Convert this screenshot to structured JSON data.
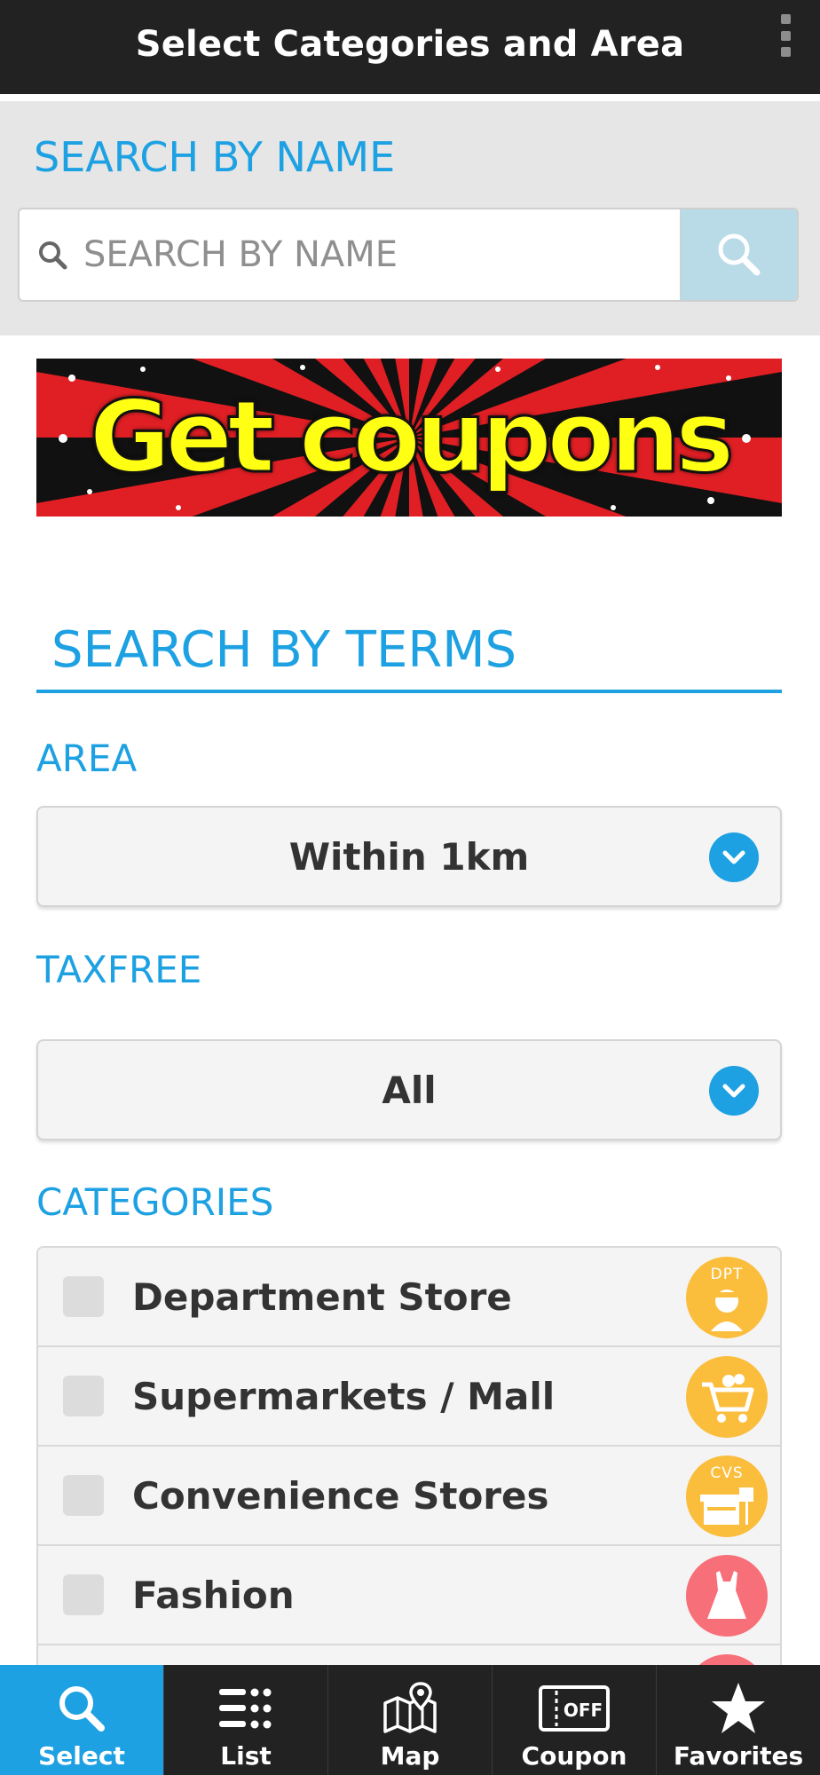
{
  "header": {
    "title": "Select Categories and Area",
    "menu_icon": "more-vertical-icon"
  },
  "search_by_name": {
    "label": "SEARCH BY NAME",
    "placeholder": "SEARCH BY NAME",
    "value": "",
    "button_icon": "search-icon"
  },
  "banner": {
    "text": "Get coupons",
    "colors": {
      "text": "#ffff14",
      "rays_red": "#e01f24",
      "rays_dark": "#111111"
    }
  },
  "search_by_terms": {
    "heading": "SEARCH BY TERMS",
    "area": {
      "label": "AREA",
      "selected": "Within 1km"
    },
    "taxfree": {
      "label": "TAXFREE",
      "selected": "All"
    },
    "categories": {
      "label": "CATEGORIES",
      "items": [
        {
          "label": "Department Store",
          "checked": false,
          "icon": "department-store-icon",
          "icon_tag": "DPT",
          "color": "#fbbd3c"
        },
        {
          "label": "Supermarkets / Mall",
          "checked": false,
          "icon": "shopping-cart-icon",
          "icon_tag": "",
          "color": "#fbbd3c"
        },
        {
          "label": "Convenience Stores",
          "checked": false,
          "icon": "convenience-store-icon",
          "icon_tag": "CVS",
          "color": "#fbbd3c"
        },
        {
          "label": "Fashion",
          "checked": false,
          "icon": "dress-icon",
          "icon_tag": "",
          "color": "#f76f78"
        },
        {
          "label": "",
          "checked": false,
          "icon": "category-icon",
          "icon_tag": "",
          "color": "#f76f78"
        }
      ]
    }
  },
  "bottom_nav": {
    "items": [
      {
        "label": "Select",
        "icon": "search-icon",
        "active": true
      },
      {
        "label": "List",
        "icon": "list-icon",
        "active": false
      },
      {
        "label": "Map",
        "icon": "map-icon",
        "active": false
      },
      {
        "label": "Coupon",
        "icon": "coupon-icon",
        "active": false
      },
      {
        "label": "Favorites",
        "icon": "star-icon",
        "active": false
      }
    ]
  },
  "colors": {
    "accent": "#1da1e2",
    "bar": "#222222",
    "panel": "#e6e6e6",
    "search_button": "#b9dbe8"
  }
}
